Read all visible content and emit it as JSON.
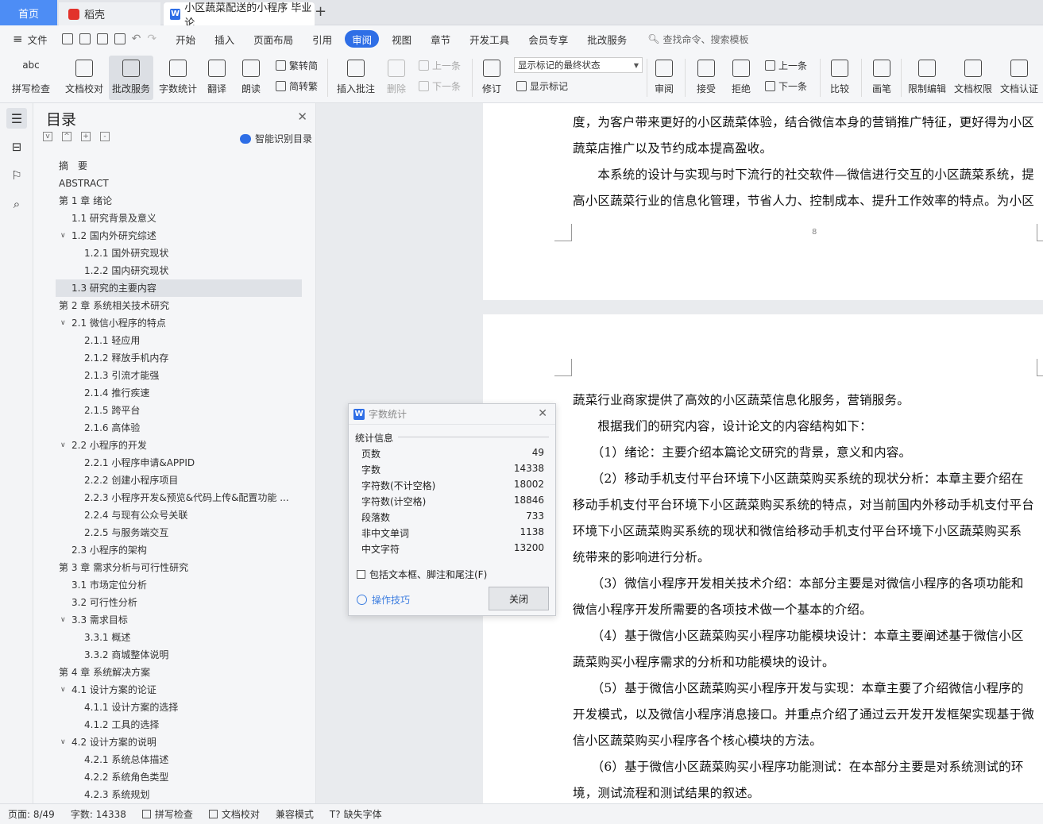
{
  "tabs": {
    "home": "首页",
    "daoke": "稻壳",
    "doc": "小区蔬菜配送的小程序 毕业论",
    "add": "+"
  },
  "menubar": {
    "file": "文件",
    "items": [
      "开始",
      "插入",
      "页面布局",
      "引用",
      "审阅",
      "视图",
      "章节",
      "开发工具",
      "会员专享",
      "批改服务"
    ],
    "active_index": 4,
    "search": "查找命令、搜索模板"
  },
  "ribbon": {
    "spell": "拼写检查",
    "proof": "文档校对",
    "review_service": "批改服务",
    "wordcount": "字数统计",
    "translate": "翻译",
    "read": "朗读",
    "trad": "繁转简",
    "simp": "简转繁",
    "insert_comment": "插入批注",
    "delete": "删除",
    "prev": "上一条",
    "next": "下一条",
    "revise": "修订",
    "markup_select": "显示标记的最终状态",
    "show_markup": "显示标记",
    "review": "审阅",
    "accept": "接受",
    "reject": "拒绝",
    "prev2": "上一条",
    "next2": "下一条",
    "compare": "比较",
    "pen": "画笔",
    "restrict": "限制编辑",
    "permission": "文档权限",
    "certify": "文档认证"
  },
  "toc": {
    "title": "目录",
    "smart": "智能识别目录",
    "items": [
      {
        "text": "摘　要",
        "level": 0,
        "caret": ""
      },
      {
        "text": "ABSTRACT",
        "level": 0,
        "caret": ""
      },
      {
        "text": "第 1 章  绪论",
        "level": 0,
        "caret": "v"
      },
      {
        "text": "1.1  研究背景及意义",
        "level": 1,
        "caret": ""
      },
      {
        "text": "1.2  国内外研究综述",
        "level": 1,
        "caret": "v"
      },
      {
        "text": "1.2.1 国外研究现状",
        "level": 2,
        "caret": ""
      },
      {
        "text": "1.2.2 国内研究现状",
        "level": 2,
        "caret": ""
      },
      {
        "text": "1.3  研究的主要内容",
        "level": 1,
        "caret": "",
        "selected": true
      },
      {
        "text": "第 2 章  系统相关技术研究",
        "level": 0,
        "caret": "v"
      },
      {
        "text": "2.1 微信小程序的特点",
        "level": 1,
        "caret": "v"
      },
      {
        "text": "2.1.1 轻应用",
        "level": 2,
        "caret": ""
      },
      {
        "text": "2.1.2 释放手机内存",
        "level": 2,
        "caret": ""
      },
      {
        "text": "2.1.3 引流才能强",
        "level": 2,
        "caret": ""
      },
      {
        "text": "2.1.4 推行疾速",
        "level": 2,
        "caret": ""
      },
      {
        "text": "2.1.5 跨平台",
        "level": 2,
        "caret": ""
      },
      {
        "text": "2.1.6 高体验",
        "level": 2,
        "caret": ""
      },
      {
        "text": "2.2 小程序的开发",
        "level": 1,
        "caret": "v"
      },
      {
        "text": "2.2.1 小程序申请&APPID",
        "level": 2,
        "caret": ""
      },
      {
        "text": "2.2.2 创建小程序项目",
        "level": 2,
        "caret": ""
      },
      {
        "text": "2.2.3 小程序开发&预览&代码上传&配置功能 ...",
        "level": 2,
        "caret": ""
      },
      {
        "text": "2.2.4 与现有公众号关联",
        "level": 2,
        "caret": ""
      },
      {
        "text": "2.2.5 与服务端交互",
        "level": 2,
        "caret": ""
      },
      {
        "text": "2.3 小程序的架构",
        "level": 1,
        "caret": ""
      },
      {
        "text": "第 3 章  需求分析与可行性研究",
        "level": 0,
        "caret": "v"
      },
      {
        "text": "3.1  市场定位分析",
        "level": 1,
        "caret": ""
      },
      {
        "text": "3.2  可行性分析",
        "level": 1,
        "caret": ""
      },
      {
        "text": "3.3  需求目标",
        "level": 1,
        "caret": "v"
      },
      {
        "text": "3.3.1  概述",
        "level": 2,
        "caret": ""
      },
      {
        "text": "3.3.2  商城整体说明",
        "level": 2,
        "caret": ""
      },
      {
        "text": "第 4 章  系统解决方案",
        "level": 0,
        "caret": "v"
      },
      {
        "text": "4.1  设计方案的论证",
        "level": 1,
        "caret": "v"
      },
      {
        "text": "4.1.1  设计方案的选择",
        "level": 2,
        "caret": ""
      },
      {
        "text": "4.1.2  工具的选择",
        "level": 2,
        "caret": ""
      },
      {
        "text": "4.2  设计方案的说明",
        "level": 1,
        "caret": "v"
      },
      {
        "text": "4.2.1  系统总体描述",
        "level": 2,
        "caret": ""
      },
      {
        "text": "4.2.2  系统角色类型",
        "level": 2,
        "caret": ""
      },
      {
        "text": "4.2.3  系统规划",
        "level": 2,
        "caret": ""
      }
    ]
  },
  "doc": {
    "page1": [
      "度，为客户带来更好的小区蔬菜体验，结合微信本身的营销推广特征，更好得为小区",
      "蔬菜店推广以及节约成本提高盈收。",
      "　　本系统的设计与实现与时下流行的社交软件—微信进行交互的小区蔬菜系统，提",
      "高小区蔬菜行业的信息化管理，节省人力、控制成本、提升工作效率的特点。为小区"
    ],
    "page_number": "8",
    "page2": [
      "蔬菜行业商家提供了高效的小区蔬菜信息化服务，营销服务。",
      "　　根据我们的研究内容，设计论文的内容结构如下：",
      "　　（1）绪论：主要介绍本篇论文研究的背景，意义和内容。",
      "　　（2）移动手机支付平台环境下小区蔬菜购买系统的现状分析：本章主要介绍在",
      "移动手机支付平台环境下小区蔬菜购买系统的特点，对当前国内外移动手机支付平台",
      "环境下小区蔬菜购买系统的现状和微信给移动手机支付平台环境下小区蔬菜购买系",
      "统带来的影响进行分析。",
      "　　（3）微信小程序开发相关技术介绍：本部分主要是对微信小程序的各项功能和",
      "微信小程序开发所需要的各项技术做一个基本的介绍。",
      "　　（4）基于微信小区蔬菜购买小程序功能模块设计：本章主要阐述基于微信小区",
      "蔬菜购买小程序需求的分析和功能模块的设计。",
      "　　（5）基于微信小区蔬菜购买小程序开发与实现：本章主要了介绍微信小程序的",
      "开发模式，以及微信小程序消息接口。并重点介绍了通过云开发开发框架实现基于微",
      "信小区蔬菜购买小程序各个核心模块的方法。",
      "　　（6）基于微信小区蔬菜购买小程序功能测试：在本部分主要是对系统测试的环",
      "境，测试流程和测试结果的叙述。"
    ]
  },
  "dialog": {
    "title": "字数统计",
    "section": "统计信息",
    "rows": [
      {
        "label": "页数",
        "value": "49"
      },
      {
        "label": "字数",
        "value": "14338"
      },
      {
        "label": "字符数(不计空格)",
        "value": "18002"
      },
      {
        "label": "字符数(计空格)",
        "value": "18846"
      },
      {
        "label": "段落数",
        "value": "733"
      },
      {
        "label": "非中文单词",
        "value": "1138"
      },
      {
        "label": "中文字符",
        "value": "13200"
      }
    ],
    "checkbox": "包括文本框、脚注和尾注(F)",
    "tips": "操作技巧",
    "close": "关闭"
  },
  "status": {
    "page": "页面: 8/49",
    "words": "字数: 14338",
    "spell": "拼写检查",
    "proof": "文档校对",
    "compat": "兼容模式",
    "missing_font": "缺失字体"
  },
  "colors": {
    "accent": "#2e6ee6",
    "home_tab": "#4d8df5",
    "link": "#3f7fe0"
  }
}
